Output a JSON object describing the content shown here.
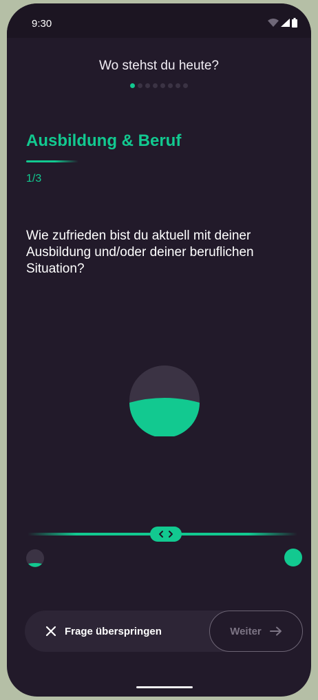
{
  "status_bar": {
    "time": "9:30",
    "icons": [
      "wifi-icon",
      "signal-icon",
      "battery-icon"
    ]
  },
  "header": {
    "title": "Wo stehst du heute?",
    "step_dots": {
      "total": 8,
      "active_index": 0
    }
  },
  "section": {
    "title": "Ausbildung & Beruf",
    "progress": "1/3"
  },
  "question": {
    "text": "Wie zufrieden bist du aktuell mit deiner Ausbildung und/oder deiner beruflichen Situation?"
  },
  "slider": {
    "value_fraction": 0.5,
    "handle_icon": "chevron-left-right-icon",
    "min_icon": "low-satisfaction-icon",
    "max_icon": "full-satisfaction-icon"
  },
  "footer": {
    "skip_label": "Frage überspringen",
    "skip_icon": "close-icon",
    "next_label": "Weiter",
    "next_icon": "arrow-right-icon"
  },
  "colors": {
    "accent": "#12c990",
    "background": "#221a2a",
    "surface": "#2d2536"
  }
}
